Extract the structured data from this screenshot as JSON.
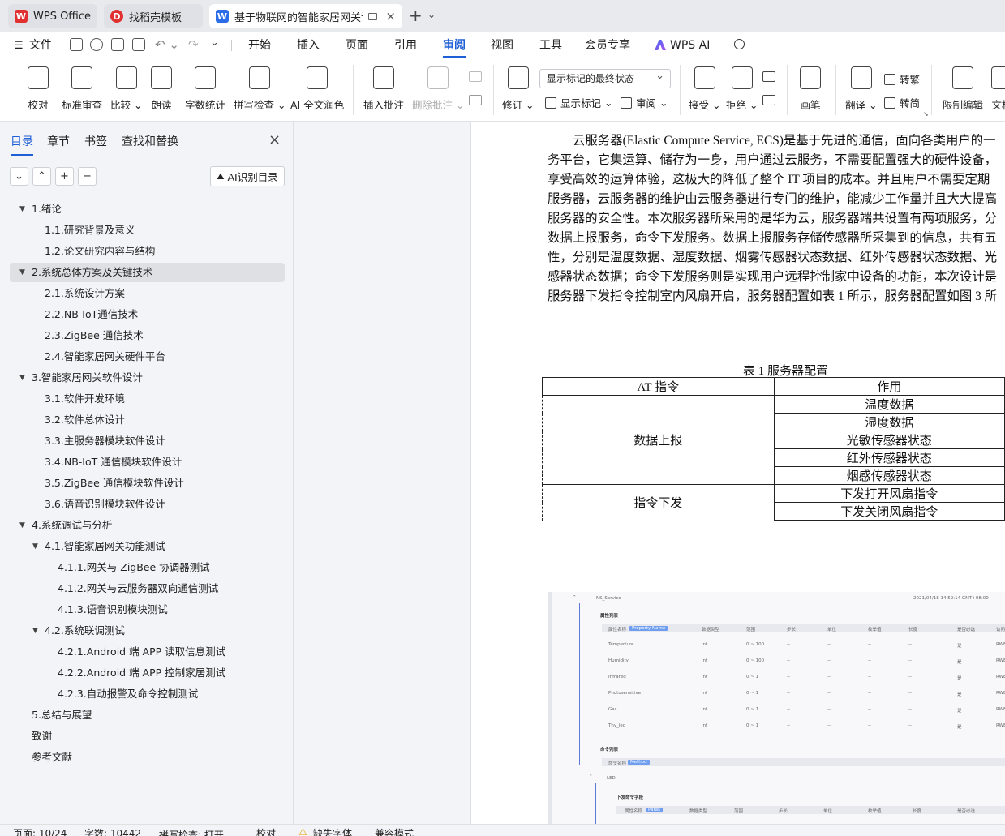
{
  "tabs": [
    {
      "label": "WPS Office"
    },
    {
      "label": "找稻壳模板"
    },
    {
      "label": "基于物联网的智能家居网关设"
    }
  ],
  "menu": {
    "file": "文件",
    "items": [
      "开始",
      "插入",
      "页面",
      "引用",
      "审阅",
      "视图",
      "工具",
      "会员专享",
      "WPS AI"
    ]
  },
  "ribbon": {
    "proofread": "校对",
    "standard_review": "标准审查",
    "compare": "比较",
    "read_aloud": "朗读",
    "word_count": "字数统计",
    "spellcheck": "拼写检查",
    "ai_polish": "AI 全文润色",
    "insert_comment": "插入批注",
    "delete_comment": "删除批注",
    "track_changes": "修订",
    "markup_mode": "显示标记的最终状态",
    "show_markup": "显示标记",
    "review_pane": "审阅",
    "accept": "接受",
    "reject": "拒绝",
    "pen": "画笔",
    "translate": "翻译",
    "to_traditional": "转繁",
    "to_simplified": "转简",
    "restrict_edit": "限制编辑",
    "doc": "文档"
  },
  "sidebar": {
    "tabs": [
      "目录",
      "章节",
      "书签",
      "查找和替换"
    ],
    "ai_button": "AI识别目录",
    "toc": [
      {
        "label": "1.绪论",
        "level": 1,
        "exp": true
      },
      {
        "label": "1.1.研究背景及意义",
        "level": 2
      },
      {
        "label": "1.2.论文研究内容与结构",
        "level": 2
      },
      {
        "label": "2.系统总体方案及关键技术",
        "level": 1,
        "exp": true,
        "sel": true
      },
      {
        "label": "2.1.系统设计方案",
        "level": 2
      },
      {
        "label": "2.2.NB-IoT通信技术",
        "level": 2
      },
      {
        "label": "2.3.ZigBee 通信技术",
        "level": 2
      },
      {
        "label": "2.4.智能家居网关硬件平台",
        "level": 2
      },
      {
        "label": "3.智能家居网关软件设计",
        "level": 1,
        "exp": true
      },
      {
        "label": "3.1.软件开发环境",
        "level": 2
      },
      {
        "label": "3.2.软件总体设计",
        "level": 2
      },
      {
        "label": "3.3.主服务器模块软件设计",
        "level": 2
      },
      {
        "label": "3.4.NB-IoT 通信模块软件设计",
        "level": 2
      },
      {
        "label": "3.5.ZigBee 通信模块软件设计",
        "level": 2
      },
      {
        "label": "3.6.语音识别模块软件设计",
        "level": 2
      },
      {
        "label": "4.系统调试与分析",
        "level": 1,
        "exp": true
      },
      {
        "label": "4.1.智能家居网关功能测试",
        "level": 2,
        "exp": true
      },
      {
        "label": "4.1.1.网关与 ZigBee 协调器测试",
        "level": 3
      },
      {
        "label": "4.1.2.网关与云服务器双向通信测试",
        "level": 3
      },
      {
        "label": "4.1.3.语音识别模块测试",
        "level": 3
      },
      {
        "label": "4.2.系统联调测试",
        "level": 2,
        "exp": true
      },
      {
        "label": "4.2.1.Android 端 APP 读取信息测试",
        "level": 3
      },
      {
        "label": "4.2.2.Android 端 APP 控制家居测试",
        "level": 3
      },
      {
        "label": "4.2.3.自动报警及命令控制测试",
        "level": 3
      },
      {
        "label": "5.总结与展望",
        "level": 1
      },
      {
        "label": "致谢",
        "level": 1
      },
      {
        "label": "参考文献",
        "level": 1
      }
    ]
  },
  "document": {
    "lines": [
      "云服务器(Elastic Compute Service, ECS)是基于先进的通信，面向各类用户的一",
      "务平台，它集运算、储存为一身，用户通过云服务，不需要配置强大的硬件设备，",
      "享受高效的运算体验，这极大的降低了整个 IT 项目的成本。并且用户不需要定期",
      "服务器，云服务器的维护由云服务器进行专门的维护，能减少工作量并且大大提高",
      "服务器的安全性。本次服务器所采用的是华为云，服务器端共设置有两项服务，分",
      "数据上报服务，命令下发服务。数据上报服务存储传感器所采集到的信息，共有五",
      "性，分别是温度数据、湿度数据、烟雾传感器状态数据、红外传感器状态数据、光",
      "感器状态数据；命令下发服务则是实现用户远程控制家中设备的功能，本次设计是",
      "服务器下发指令控制室内风扇开启，服务器配置如表 1 所示，服务器配置如图 3 所"
    ],
    "table_caption": "表 1  服务器配置",
    "table": {
      "h1": "AT 指令",
      "h2": "作用",
      "g1": "数据上报",
      "g1_items": [
        "温度数据",
        "湿度数据",
        "光敏传感器状态",
        "红外传感器状态",
        "烟感传感器状态"
      ],
      "g2": "指令下发",
      "g2_items": [
        "下发打开风扇指令",
        "下发关闭风扇指令"
      ]
    },
    "screenshot": {
      "service": "NS_Service",
      "time": "2021/04/18 14:59:14 GMT+08:00",
      "props_title": "属性列表",
      "prop_headers": [
        "属性名称",
        "数据类型",
        "范围",
        "步长",
        "单位",
        "枚举值",
        "长度",
        "是否必选",
        "访问模式"
      ],
      "prop_chip": "Property Name",
      "props": [
        {
          "name": "Temperture",
          "type": "int",
          "range": "0 ~ 100",
          "req": "是",
          "mode": "RWE"
        },
        {
          "name": "Humidity",
          "type": "int",
          "range": "0 ~ 100",
          "req": "是",
          "mode": "RWE"
        },
        {
          "name": "Infrared",
          "type": "int",
          "range": "0 ~ 1",
          "req": "是",
          "mode": "RWE"
        },
        {
          "name": "Photosensitive",
          "type": "int",
          "range": "0 ~ 1",
          "req": "是",
          "mode": "RWE"
        },
        {
          "name": "Gas",
          "type": "int",
          "range": "0 ~ 1",
          "req": "是",
          "mode": "RWE"
        },
        {
          "name": "Thy_led",
          "type": "int",
          "range": "0 ~ 1",
          "req": "是",
          "mode": "RWE"
        }
      ],
      "cmd_title": "命令列表",
      "cmd_header": "命令名称",
      "cmd_chip": "Method",
      "cmd_name": "LED",
      "sub_title": "下发命令字段",
      "sub_headers": [
        "属性名称",
        "数据类型",
        "范围",
        "步长",
        "单位",
        "枚举值",
        "长度",
        "是否必选"
      ],
      "sub_chip": "Paras",
      "dash": "--"
    }
  },
  "status": {
    "page": "页面: 10/24",
    "words": "字数: 10442",
    "spell": "拼写检查: 打开",
    "proof": "校对",
    "missing_font": "缺失字体",
    "compat": "兼容模式"
  },
  "colors": {
    "accent": "#1f5fd6",
    "wps_red": "#e0302f"
  }
}
